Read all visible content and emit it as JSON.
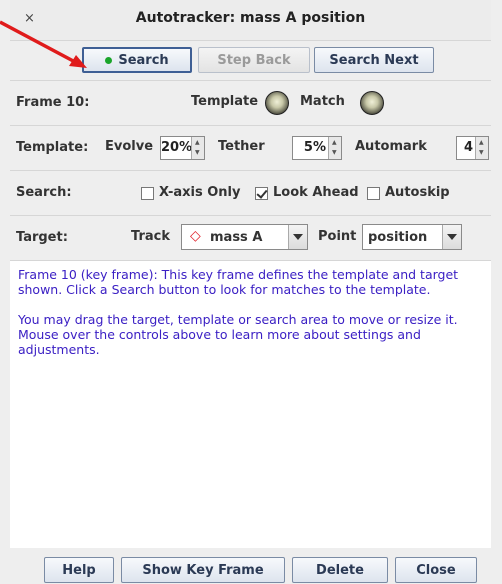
{
  "window": {
    "title": "Autotracker: mass A position",
    "close_glyph": "×"
  },
  "toolbar": {
    "search_label": "Search",
    "step_back_label": "Step Back",
    "search_next_label": "Search Next"
  },
  "frame_row": {
    "label": "Frame 10:",
    "template_label": "Template",
    "match_label": "Match"
  },
  "template_row": {
    "label": "Template:",
    "evolve_label": "Evolve",
    "evolve_value": "20%",
    "tether_label": "Tether",
    "tether_value": "5%",
    "automark_label": "Automark",
    "automark_value": "4"
  },
  "search_row": {
    "label": "Search:",
    "x_axis_only_label": "X-axis Only",
    "x_axis_only_checked": false,
    "look_ahead_label": "Look Ahead",
    "look_ahead_checked": true,
    "autoskip_label": "Autoskip",
    "autoskip_checked": false
  },
  "target_row": {
    "label": "Target:",
    "track_label": "Track",
    "track_value": "mass A",
    "point_label": "Point",
    "point_value": "position"
  },
  "info": {
    "paragraph1": "Frame 10 (key frame): This key frame defines the template and target shown. Click a Search button to look for matches to the template.",
    "paragraph2": "You may drag the target, template or search area to move or resize it.  Mouse over the controls above to learn more about settings and adjustments."
  },
  "footer": {
    "help_label": "Help",
    "show_key_frame_label": "Show Key Frame",
    "delete_label": "Delete",
    "close_label": "Close"
  },
  "colors": {
    "info_text": "#3b20c4",
    "annotation_arrow": "#e01b1b",
    "search_dot": "#1aa52a",
    "track_marker": "#e0202a"
  },
  "icons": {
    "close": "close-icon",
    "search_status": "green-dot-icon",
    "template": "template-circle-icon",
    "match": "match-circle-icon",
    "track_marker": "diamond-icon",
    "dropdown": "chevron-down-icon"
  }
}
